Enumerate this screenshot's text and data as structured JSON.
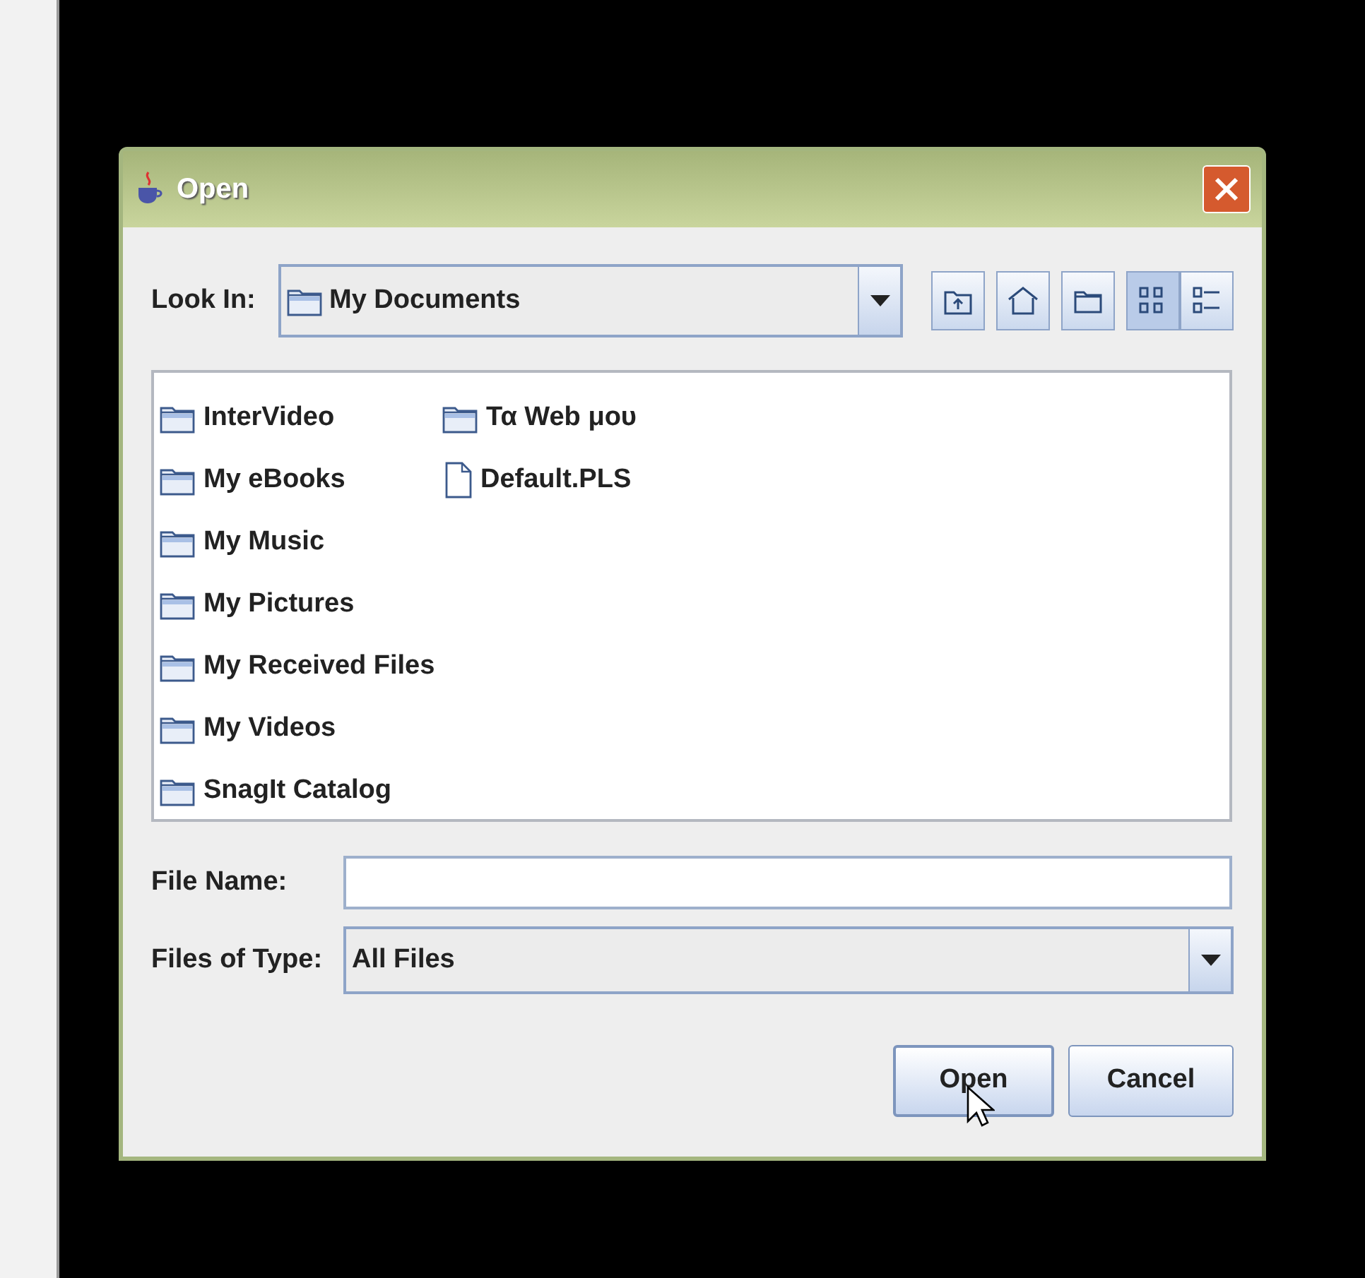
{
  "dialog": {
    "title": "Open",
    "look_in": {
      "label": "Look In:",
      "value": "My Documents"
    },
    "toolbar": [
      {
        "kind": "up",
        "selected": false
      },
      {
        "kind": "home",
        "selected": false
      },
      {
        "kind": "new-folder",
        "selected": false
      },
      {
        "kind": "list",
        "selected": true
      },
      {
        "kind": "details",
        "selected": false
      }
    ],
    "files": [
      {
        "kind": "folder",
        "name": "InterVideo"
      },
      {
        "kind": "folder",
        "name": "My eBooks"
      },
      {
        "kind": "folder",
        "name": "My Music"
      },
      {
        "kind": "folder",
        "name": "My Pictures"
      },
      {
        "kind": "folder",
        "name": "My Received Files"
      },
      {
        "kind": "folder",
        "name": "My Videos"
      },
      {
        "kind": "folder",
        "name": "SnagIt Catalog"
      },
      {
        "kind": "folder",
        "name": "Τα Web μου"
      },
      {
        "kind": "file",
        "name": "Default.PLS"
      }
    ],
    "file_name": {
      "label": "File Name:"
    },
    "file_type": {
      "label": "Files of Type:",
      "value": "All Files"
    },
    "buttons": [
      {
        "label": "Open",
        "kind": "primary"
      },
      {
        "label": "Cancel",
        "kind": "normal"
      }
    ]
  }
}
